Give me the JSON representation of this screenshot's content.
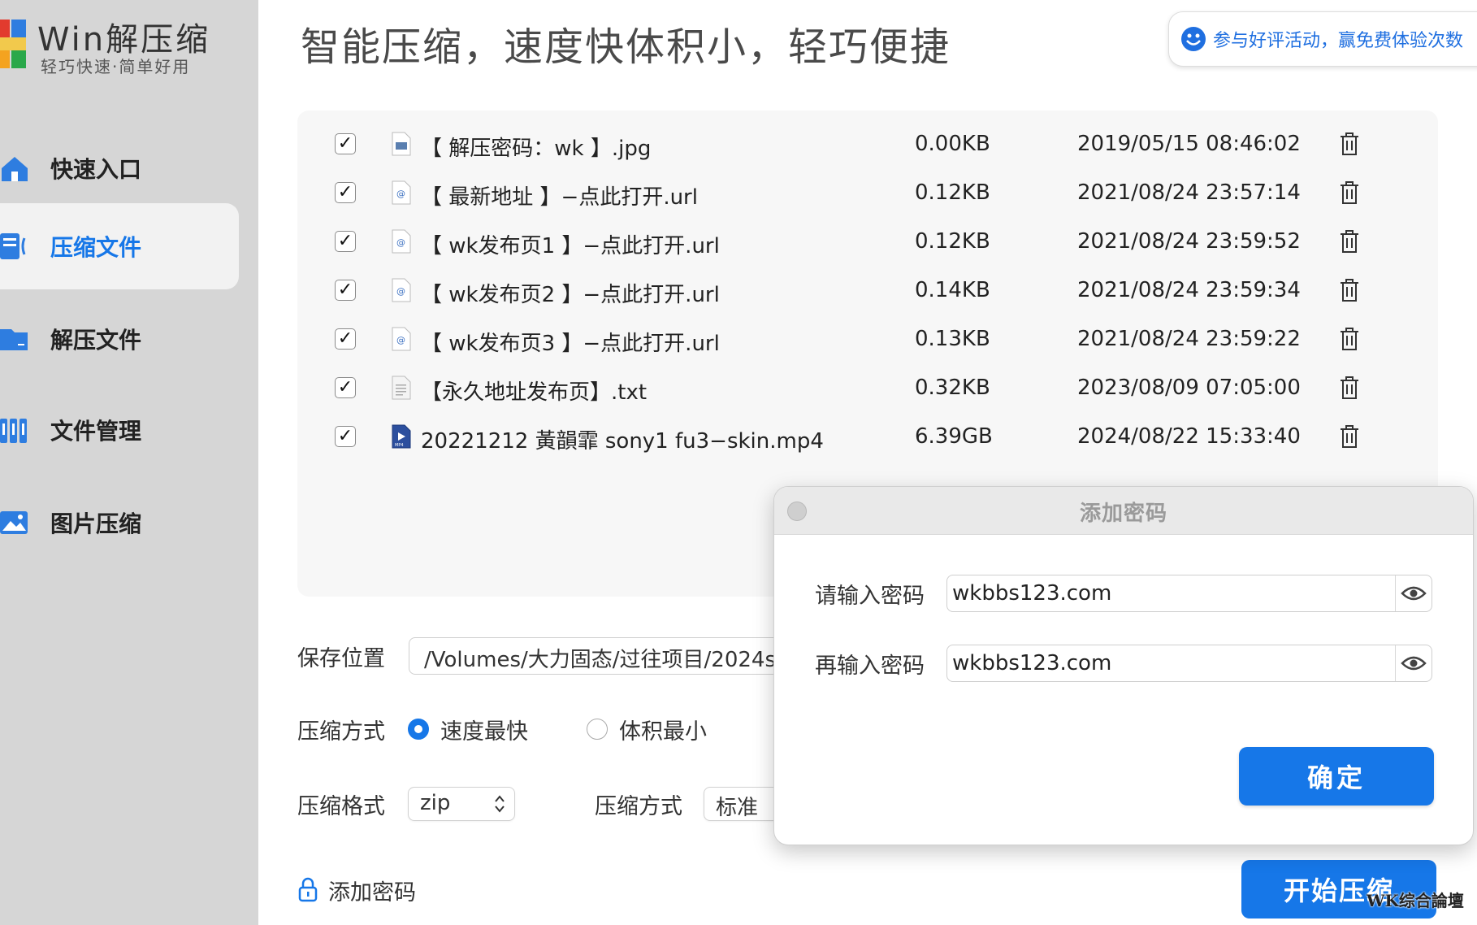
{
  "app": {
    "title": "Win解压缩",
    "subtitle": "轻巧快速·简单好用"
  },
  "sidebar": {
    "items": [
      {
        "label": "快速入口",
        "icon": "home-icon",
        "active": false
      },
      {
        "label": "压缩文件",
        "icon": "compress-file-icon",
        "active": true
      },
      {
        "label": "解压文件",
        "icon": "folder-icon",
        "active": false
      },
      {
        "label": "文件管理",
        "icon": "binders-icon",
        "active": false
      },
      {
        "label": "图片压缩",
        "icon": "image-icon",
        "active": false
      }
    ]
  },
  "header": {
    "title": "智能压缩，速度快体积小，轻巧便捷",
    "promo": "参与好评活动，赢免费体验次数"
  },
  "files": [
    {
      "checked": true,
      "icon": "image-file-icon",
      "name": "【 解压密码：wk 】.jpg",
      "size": "0.00KB",
      "date": "2019/05/15 08:46:02"
    },
    {
      "checked": true,
      "icon": "url-file-icon",
      "name": "【 最新地址 】−点此打开.url",
      "size": "0.12KB",
      "date": "2021/08/24 23:57:14"
    },
    {
      "checked": true,
      "icon": "url-file-icon",
      "name": "【 wk发布页1 】−点此打开.url",
      "size": "0.12KB",
      "date": "2021/08/24 23:59:52"
    },
    {
      "checked": true,
      "icon": "url-file-icon",
      "name": "【 wk发布页2 】−点此打开.url",
      "size": "0.14KB",
      "date": "2021/08/24 23:59:34"
    },
    {
      "checked": true,
      "icon": "url-file-icon",
      "name": "【 wk发布页3 】−点此打开.url",
      "size": "0.13KB",
      "date": "2021/08/24 23:59:22"
    },
    {
      "checked": true,
      "icon": "text-file-icon",
      "name": "【永久地址发布页】.txt",
      "size": "0.32KB",
      "date": "2023/08/09 07:05:00"
    },
    {
      "checked": true,
      "icon": "video-file-icon",
      "name": "20221212 黃韻霏 sony1 fu3−skin.mp4",
      "size": "6.39GB",
      "date": "2024/08/22 15:33:40"
    }
  ],
  "options": {
    "save_location_label": "保存位置",
    "save_location_value": "/Volumes/大力固态/过往项目/2024s",
    "compress_mode_label": "压缩方式",
    "mode_fast": "速度最快",
    "mode_small": "体积最小",
    "format_label": "压缩格式",
    "format_value": "zip",
    "method_label": "压缩方式",
    "method_value": "标准",
    "add_password": "添加密码",
    "start_button": "开始压缩"
  },
  "dialog": {
    "title": "添加密码",
    "password_label": "请输入密码",
    "password_value": "wkbbs123.com",
    "confirm_label": "再输入密码",
    "confirm_value": "wkbbs123.com",
    "ok_button": "确定"
  },
  "watermark": "WK综合論壇",
  "colors": {
    "accent": "#1677e8",
    "sidebar": "#d6d6d6",
    "panel": "#f7f7f7"
  }
}
